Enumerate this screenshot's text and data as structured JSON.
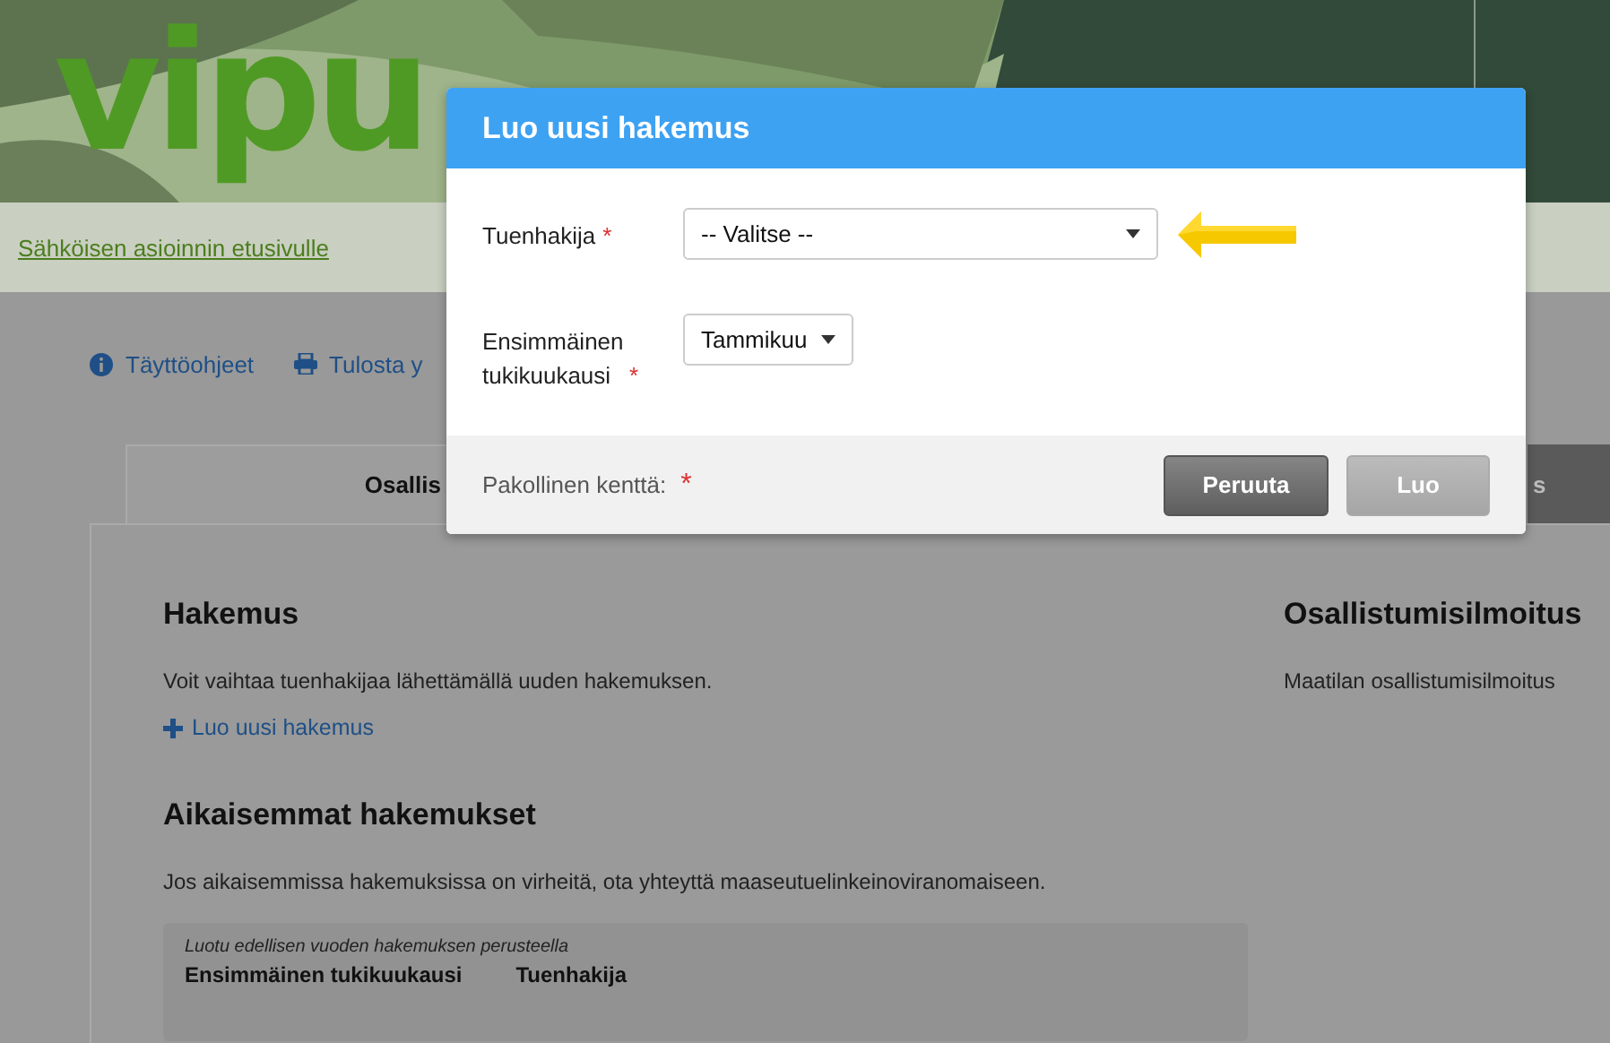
{
  "header": {
    "logo": "vipu"
  },
  "home_link": "Sähköisen asioinnin etusivulle",
  "toolbar": [
    {
      "kind": "info",
      "label": "Täyttöohjeet"
    },
    {
      "kind": "print",
      "label": "Tulosta y"
    }
  ],
  "tabs": [
    {
      "label": "Osallis",
      "selected": true
    },
    {
      "label": "s",
      "selected": false
    }
  ],
  "left": {
    "title": "Hakemus",
    "text": "Voit vaihtaa tuenhakijaa lähettämällä uuden hakemuksen.",
    "add_link": "Luo uusi hakemus",
    "previous_title": "Aikaisemmat hakemukset",
    "previous_text": "Jos aikaisemmissa hakemuksissa on virheitä, ota yhteyttä maaseutuelinkeinoviranomaiseen.",
    "card": {
      "note": "Luotu edellisen vuoden hakemuksen perusteella",
      "columns": [
        "Ensimmäinen tukikuukausi",
        "Tuenhakija"
      ]
    }
  },
  "right": {
    "title": "Osallistumisilmoitus",
    "text": "Maatilan osallistumisilmoitus"
  },
  "modal": {
    "title": "Luo uusi hakemus",
    "required_mark": "*",
    "fields": [
      {
        "label": "Tuenhakija",
        "required": true,
        "value": "-- Valitse --",
        "pointer": true
      },
      {
        "label": "Ensimmäinen tukikuukausi",
        "required": true,
        "value": "Tammikuu",
        "pointer": false
      }
    ],
    "required_note": "Pakollinen kenttä:",
    "required_note_mark": "*",
    "buttons": [
      {
        "label": "Peruuta",
        "kind": "secondary"
      },
      {
        "label": "Luo",
        "kind": "disabled"
      }
    ]
  }
}
